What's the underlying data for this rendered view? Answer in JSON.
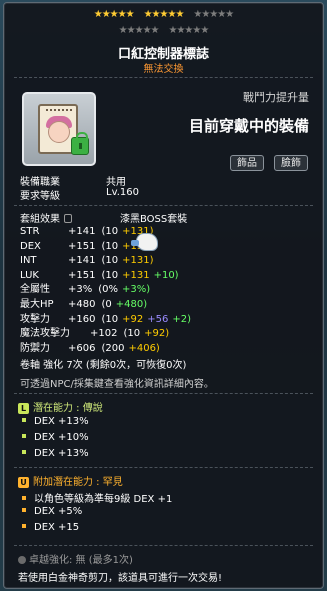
{
  "stars": {
    "filled_count": 10,
    "total": 25
  },
  "item": {
    "name": "口紅控制器標誌",
    "trade_status": "無法交換"
  },
  "power": {
    "label": "戰鬥力提升量",
    "equipped_label": "目前穿戴中的裝備"
  },
  "tags": [
    "飾品",
    "臉飾"
  ],
  "info": {
    "job_label": "裝備職業",
    "job_value": "共用",
    "level_label": "要求等級",
    "level_value": "Lv.160"
  },
  "set": {
    "label": "套組效果",
    "name": "漆黑BOSS套裝"
  },
  "stats": [
    {
      "label": "STR",
      "total": "+141",
      "base": "(10",
      "bonus": [
        {
          "v": "+131)",
          "c": "g"
        }
      ]
    },
    {
      "label": "DEX",
      "total": "+151",
      "base": "(10",
      "bonus": [
        {
          "v": "+131",
          "c": "g"
        }
      ]
    },
    {
      "label": "INT",
      "total": "+141",
      "base": "(10",
      "bonus": [
        {
          "v": "+131)",
          "c": "g"
        }
      ]
    },
    {
      "label": "LUK",
      "total": "+151",
      "base": "(10",
      "bonus": [
        {
          "v": "+131",
          "c": "g"
        },
        {
          "v": "+10)",
          "c": "gr"
        }
      ]
    },
    {
      "label": "全屬性",
      "total": "+3%",
      "base": "(0%",
      "bonus": [
        {
          "v": "+3%)",
          "c": "gr"
        }
      ]
    },
    {
      "label": "最大HP",
      "total": "+480",
      "base": "(0",
      "bonus": [
        {
          "v": "+480)",
          "c": "gr"
        }
      ]
    },
    {
      "label": "攻擊力",
      "total": "+160",
      "base": "(10",
      "bonus": [
        {
          "v": "+92",
          "c": "g"
        },
        {
          "v": "+56",
          "c": "p"
        },
        {
          "v": "+2)",
          "c": "gr"
        }
      ]
    },
    {
      "label": "魔法攻擊力",
      "total": "+102",
      "base": "(10",
      "bonus": [
        {
          "v": "+92)",
          "c": "g"
        }
      ]
    },
    {
      "label": "防禦力",
      "total": "+606",
      "base": "(200",
      "bonus": [
        {
          "v": "+406)",
          "c": "g"
        }
      ]
    }
  ],
  "scroll_line": "卷軸 強化 7次 (剩餘0次，可恢復0次)",
  "notice_line": "可透過NPC/採集鍵查看強化資訊詳細內容。",
  "potential": {
    "header_prefix": "潛在能力 : ",
    "header_grade": "傳說",
    "badge": "L",
    "badge_color": "#c8e65a",
    "lines": [
      "DEX +13%",
      "DEX +10%",
      "DEX +13%"
    ]
  },
  "additional_potential": {
    "header_prefix": "附加潛在能力 : ",
    "header_grade": "罕見",
    "badge": "U",
    "badge_color": "#ffb22e",
    "lines": [
      "以角色等級為準每9級 DEX +1",
      "DEX +5%",
      "DEX +15"
    ]
  },
  "star_force": "卓越強化: 無 (最多1次)",
  "footer": "若使用白金神奇剪刀，該道具可進行一次交易!",
  "colors": {
    "gold": "#ffcc00",
    "purple": "#9b8cff",
    "green": "#66ff66",
    "orange": "#ff9933"
  }
}
